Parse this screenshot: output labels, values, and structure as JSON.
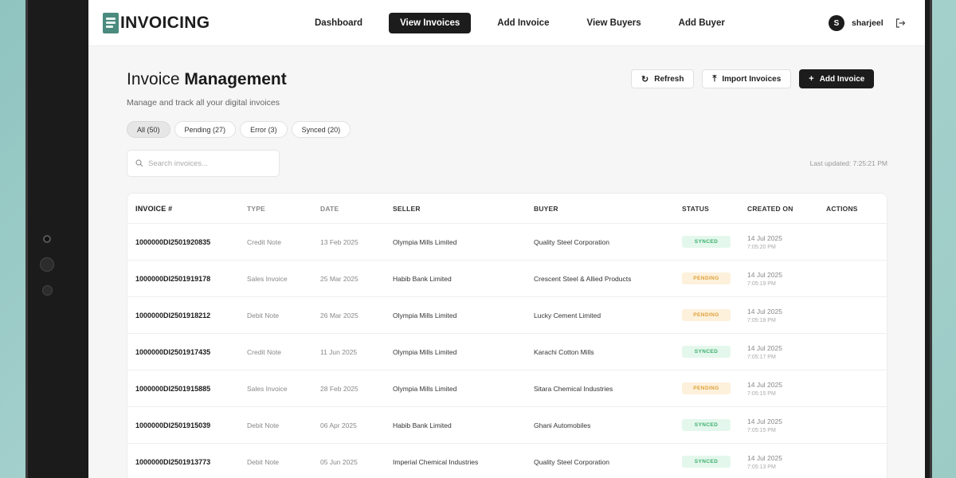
{
  "brand": {
    "name": "INVOICING"
  },
  "nav": {
    "items": [
      {
        "label": "Dashboard"
      },
      {
        "label": "View Invoices"
      },
      {
        "label": "Add Invoice"
      },
      {
        "label": "View Buyers"
      },
      {
        "label": "Add Buyer"
      }
    ],
    "active_index": 1
  },
  "user": {
    "initial": "S",
    "name": "sharjeel"
  },
  "page": {
    "title_light": "Invoice",
    "title_bold": "Management",
    "subtitle": "Manage and track all your digital invoices"
  },
  "actions": {
    "refresh": "Refresh",
    "import": "Import Invoices",
    "add": "Add Invoice"
  },
  "filters": [
    {
      "label": "All (50)",
      "active": true
    },
    {
      "label": "Pending (27)",
      "active": false
    },
    {
      "label": "Error (3)",
      "active": false
    },
    {
      "label": "Synced (20)",
      "active": false
    }
  ],
  "search": {
    "placeholder": "Search invoices...",
    "value": ""
  },
  "last_updated": "Last updated: 7:25:21 PM",
  "table": {
    "columns": [
      "INVOICE #",
      "TYPE",
      "DATE",
      "SELLER",
      "BUYER",
      "STATUS",
      "CREATED ON",
      "ACTIONS"
    ],
    "rows": [
      {
        "invoice": "1000000DI2501920835",
        "type": "Credit Note",
        "date": "13 Feb 2025",
        "seller": "Olympia Mills Limited",
        "buyer": "Quality Steel Corporation",
        "status": "SYNCED",
        "created_date": "14 Jul 2025",
        "created_time": "7:05:20 PM"
      },
      {
        "invoice": "1000000DI2501919178",
        "type": "Sales Invoice",
        "date": "25 Mar 2025",
        "seller": "Habib Bank Limited",
        "buyer": "Crescent Steel & Allied Products",
        "status": "PENDING",
        "created_date": "14 Jul 2025",
        "created_time": "7:05:19 PM"
      },
      {
        "invoice": "1000000DI2501918212",
        "type": "Debit Note",
        "date": "26 Mar 2025",
        "seller": "Olympia Mills Limited",
        "buyer": "Lucky Cement Limited",
        "status": "PENDING",
        "created_date": "14 Jul 2025",
        "created_time": "7:05:18 PM"
      },
      {
        "invoice": "1000000DI2501917435",
        "type": "Credit Note",
        "date": "11 Jun 2025",
        "seller": "Olympia Mills Limited",
        "buyer": "Karachi Cotton Mills",
        "status": "SYNCED",
        "created_date": "14 Jul 2025",
        "created_time": "7:05:17 PM"
      },
      {
        "invoice": "1000000DI2501915885",
        "type": "Sales Invoice",
        "date": "28 Feb 2025",
        "seller": "Olympia Mills Limited",
        "buyer": "Sitara Chemical Industries",
        "status": "PENDING",
        "created_date": "14 Jul 2025",
        "created_time": "7:05:15 PM"
      },
      {
        "invoice": "1000000DI2501915039",
        "type": "Debit Note",
        "date": "06 Apr 2025",
        "seller": "Habib Bank Limited",
        "buyer": "Ghani Automobiles",
        "status": "SYNCED",
        "created_date": "14 Jul 2025",
        "created_time": "7:05:15 PM"
      },
      {
        "invoice": "1000000DI2501913773",
        "type": "Debit Note",
        "date": "05 Jun 2025",
        "seller": "Imperial Chemical Industries",
        "buyer": "Quality Steel Corporation",
        "status": "SYNCED",
        "created_date": "14 Jul 2025",
        "created_time": "7:05:13 PM"
      }
    ]
  },
  "icons": {
    "logo": "document-icon",
    "logout": "logout-icon",
    "refresh": "refresh-icon",
    "import": "upload-icon",
    "add": "plus-icon",
    "search": "search-icon"
  },
  "colors": {
    "accent_dark": "#1c1c1c",
    "brand_icon": "#4a8a7f",
    "synced_bg": "#e4f7ec",
    "synced_text": "#3bb06c",
    "pending_bg": "#fdf1dc",
    "pending_text": "#e0a039"
  }
}
